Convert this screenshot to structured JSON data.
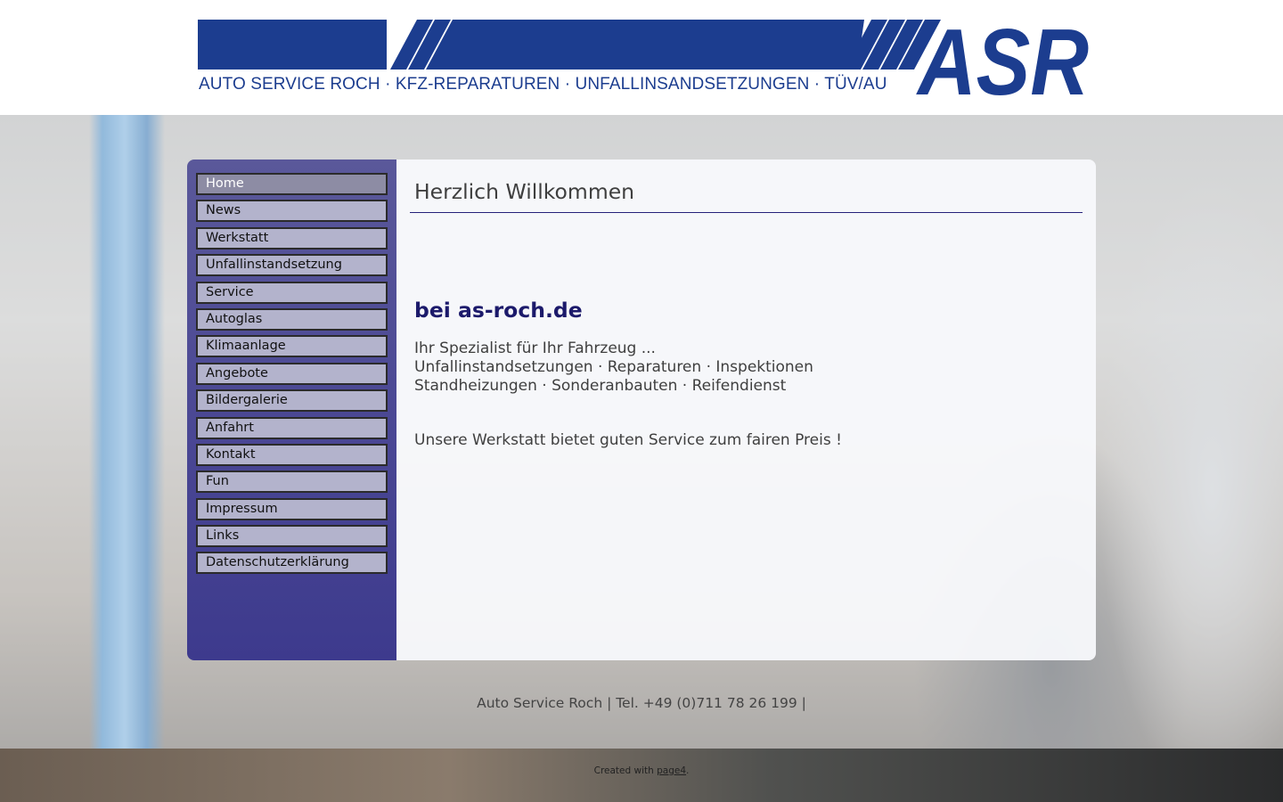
{
  "header": {
    "logo_letters": "ASR",
    "tagline": "AUTO SERVICE ROCH · KFZ-REPARATUREN · UNFALLINSANDSETZUNGEN · TÜV/AU",
    "brand_color": "#1c3d8f"
  },
  "sidebar": {
    "items": [
      {
        "label": "Home",
        "active": true
      },
      {
        "label": "News"
      },
      {
        "label": "Werkstatt"
      },
      {
        "label": "Unfallinstandsetzung"
      },
      {
        "label": "Service"
      },
      {
        "label": "Autoglas"
      },
      {
        "label": "Klimaanlage"
      },
      {
        "label": "Angebote"
      },
      {
        "label": "Bildergalerie"
      },
      {
        "label": "Anfahrt"
      },
      {
        "label": "Kontakt"
      },
      {
        "label": "Fun"
      },
      {
        "label": "Impressum"
      },
      {
        "label": "Links"
      },
      {
        "label": "Datenschutzerklärung"
      }
    ]
  },
  "main": {
    "title": "Herzlich Willkommen",
    "subtitle": "bei as-roch.de",
    "lines": [
      "Ihr Spezialist für Ihr Fahrzeug ...",
      "Unfallinstandsetzungen · Reparaturen · Inspektionen",
      "Standheizungen · Sonderanbauten · Reifendienst"
    ],
    "tagline": "Unsere Werkstatt bietet guten Service zum fairen Preis !"
  },
  "footer": {
    "contact": "Auto Service Roch | Tel. +49 (0)711 78 26 199 |",
    "credit_prefix": "Created with",
    "credit_link": "page4",
    "credit_suffix": "."
  }
}
